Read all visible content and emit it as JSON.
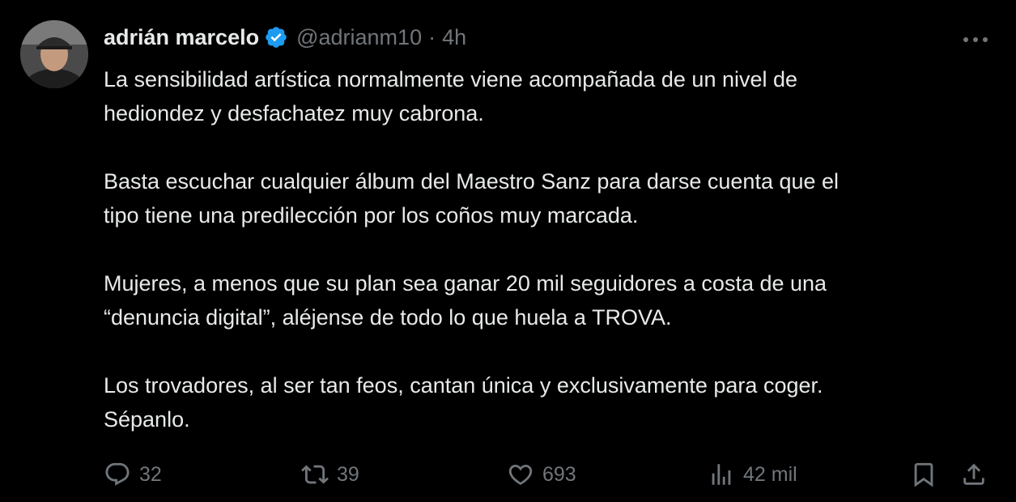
{
  "author": {
    "name": "adrián marcelo",
    "handle": "@adrianm10",
    "separator": "·",
    "time": "4h"
  },
  "tweet": {
    "paragraphs": [
      [
        "La sensibilidad artística normalmente viene acompañada de un nivel de",
        "hediondez y desfachatez muy cabrona."
      ],
      [
        "Basta escuchar cualquier álbum del Maestro Sanz para darse cuenta que el",
        "tipo tiene una predilección por los coños muy marcada."
      ],
      [
        "Mujeres, a menos que su plan sea ganar 20 mil seguidores a costa de una",
        "“denuncia digital”, aléjense de todo lo que huela a TROVA."
      ],
      [
        "Los trovadores, al ser tan feos, cantan única y exclusivamente para coger.",
        "Sépanlo."
      ]
    ]
  },
  "actions": {
    "replies": "32",
    "retweets": "39",
    "likes": "693",
    "views": "42 mil"
  },
  "colors": {
    "background": "#000000",
    "text": "#e7e9ea",
    "muted": "#71767b",
    "verified": "#1d9bf0"
  },
  "icons": [
    "more-icon",
    "verified-badge-icon",
    "reply-icon",
    "retweet-icon",
    "like-icon",
    "views-icon",
    "bookmark-icon",
    "share-icon"
  ]
}
